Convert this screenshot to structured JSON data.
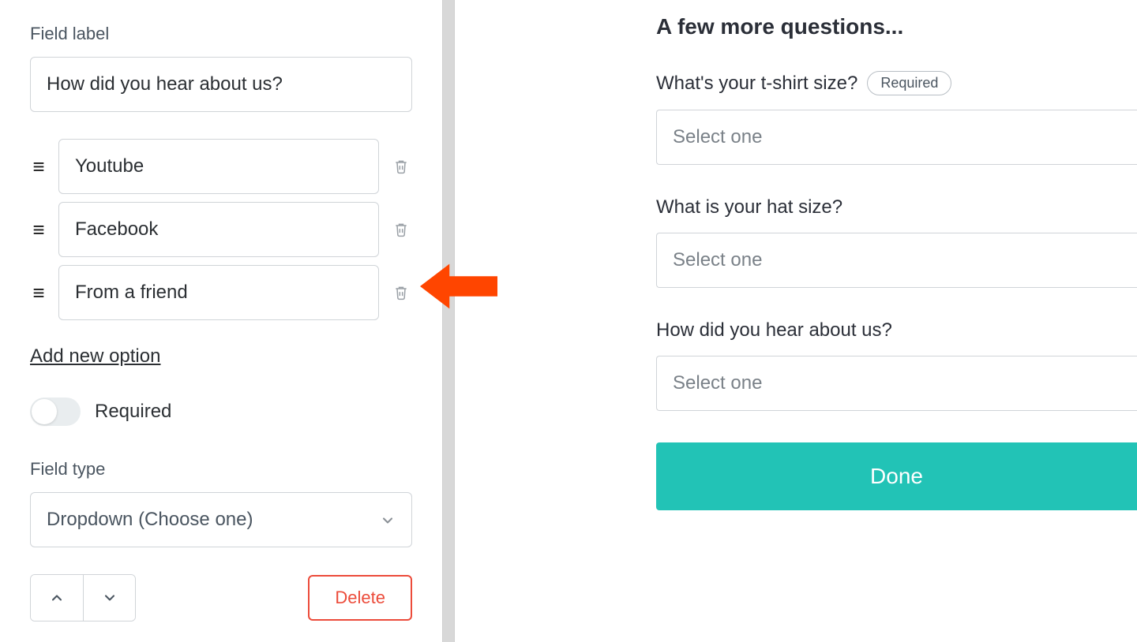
{
  "editor": {
    "field_label_heading": "Field label",
    "field_label_value": "How did you hear about us?",
    "options": [
      {
        "value": "Youtube"
      },
      {
        "value": "Facebook"
      },
      {
        "value": "From a friend"
      }
    ],
    "add_option": "Add new option",
    "required_label": "Required",
    "required_on": false,
    "field_type_heading": "Field type",
    "field_type_value": "Dropdown (Choose one)",
    "delete_label": "Delete"
  },
  "preview": {
    "title": "A few more questions...",
    "questions": [
      {
        "label": "What's your t-shirt size?",
        "required": true,
        "placeholder": "Select one"
      },
      {
        "label": "What is your hat size?",
        "required": false,
        "placeholder": "Select one"
      },
      {
        "label": "How did you hear about us?",
        "required": false,
        "placeholder": "Select one"
      }
    ],
    "required_pill": "Required",
    "done_label": "Done"
  },
  "colors": {
    "accent_teal": "#22c3b6",
    "danger_red": "#ec4b3a",
    "annotation_orange": "#ff4500"
  }
}
